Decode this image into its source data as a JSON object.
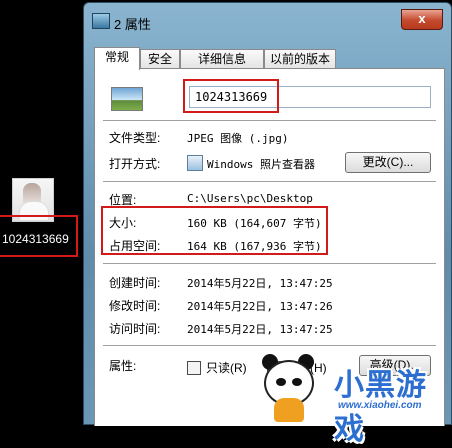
{
  "desktop": {
    "icon_label": "1024313669"
  },
  "window": {
    "title": "2 属性",
    "close_glyph": "x",
    "tabs": [
      "常规",
      "安全",
      "详细信息",
      "以前的版本"
    ]
  },
  "general": {
    "file_name": "1024313669",
    "file_type_label": "文件类型:",
    "file_type_value": "JPEG 图像 (.jpg)",
    "open_with_label": "打开方式:",
    "open_with_value": "Windows 照片查看器",
    "change_button": "更改(C)...",
    "location_label": "位置:",
    "location_value": "C:\\Users\\pc\\Desktop",
    "size_label": "大小:",
    "size_value": "160 KB (164,607 字节)",
    "size_on_disk_label": "占用空间:",
    "size_on_disk_value": "164 KB (167,936 字节)",
    "created_label": "创建时间:",
    "created_value": "2014年5月22日, 13:47:25",
    "modified_label": "修改时间:",
    "modified_value": "2014年5月22日, 13:47:26",
    "accessed_label": "访问时间:",
    "accessed_value": "2014年5月22日, 13:47:25",
    "attributes_label": "属性:",
    "readonly_label": "只读(R)",
    "hidden_label": "隐藏(H)",
    "advanced_button": "高级(D)..."
  },
  "watermark": {
    "brand": "小黑游戏",
    "url": "www.xiaohei.com"
  },
  "colors": {
    "highlight_box": "#d21a1a",
    "window_frame": "#6b97b6",
    "watermark": "#2c6fd0"
  },
  "icons": [
    "desktop-photo-icon",
    "window-title-icon",
    "close-icon",
    "jpeg-file-icon",
    "photo-viewer-icon",
    "panda-mascot-icon"
  ]
}
